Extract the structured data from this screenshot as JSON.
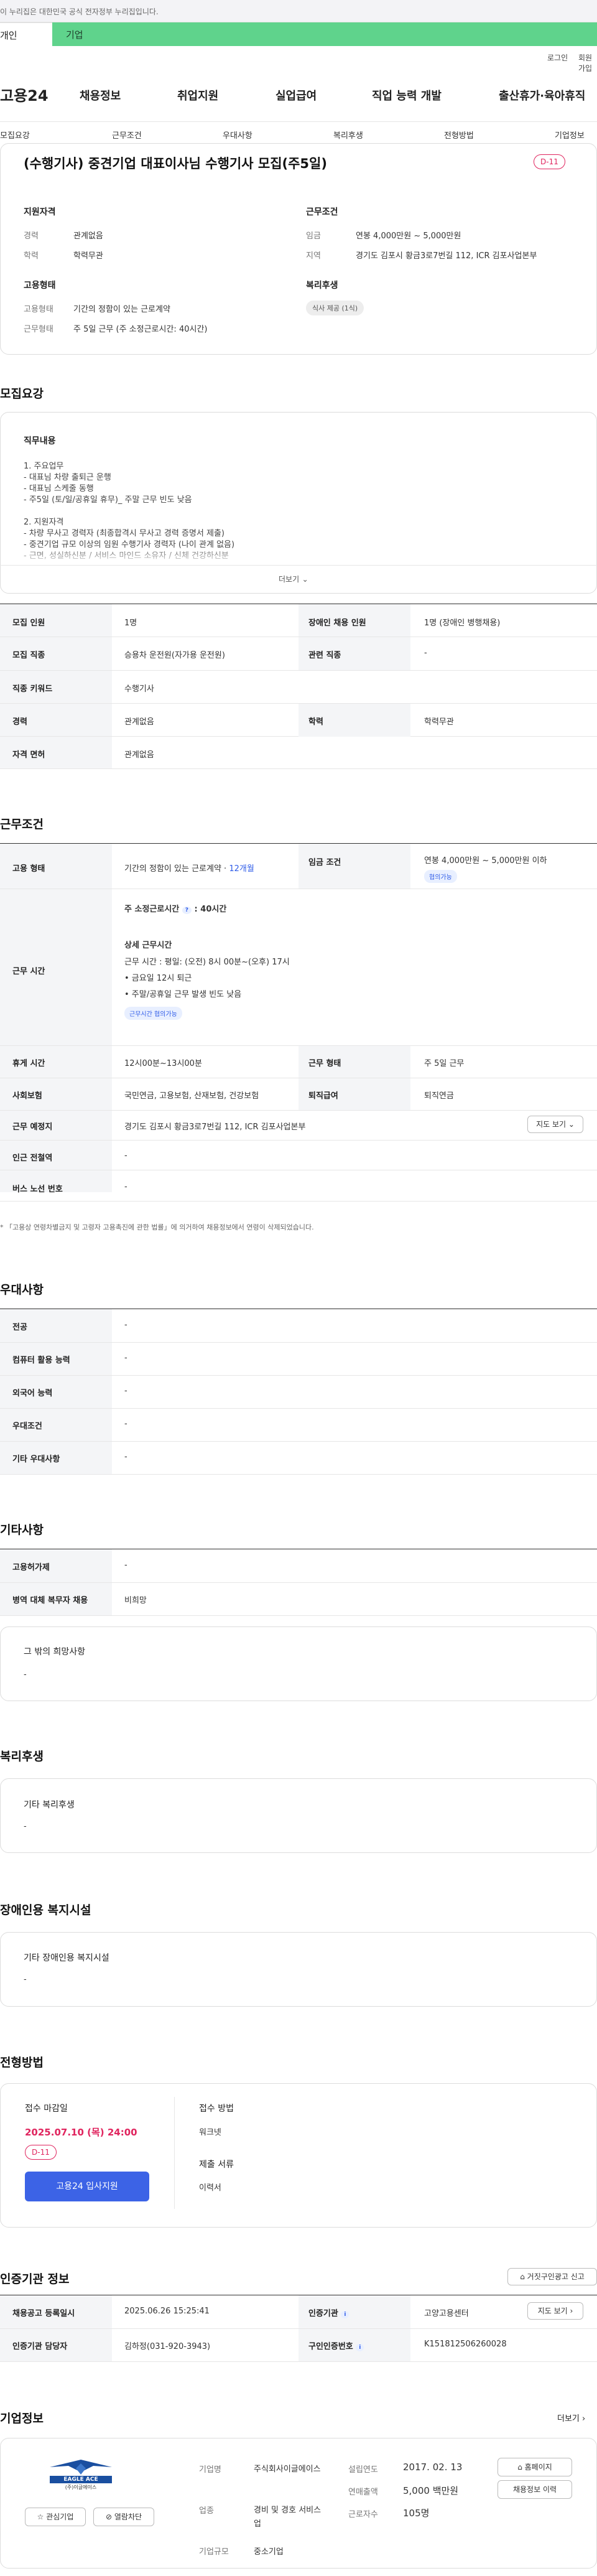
{
  "banner": {
    "text": "이 누리집은 대한민국 공식 전자정부 누리집입니다."
  },
  "user_tabs": {
    "user": "개인",
    "corp": "기업"
  },
  "utility": {
    "login": "로그인",
    "join": "회원가입"
  },
  "header": {
    "logo": "고용24",
    "gnb": [
      "채용정보",
      "취업지원",
      "실업급여",
      "직업 능력 개발",
      "출산휴가·육아휴직"
    ]
  },
  "subtabs": [
    "모집요강",
    "근무조건",
    "우대사항",
    "복리후생",
    "전형방법",
    "기업정보"
  ],
  "summary": {
    "title": "(수행기사) 중견기업 대표이사님 수행기사 모집(주5일)",
    "dday": "D-11",
    "qual": {
      "heading": "지원자격",
      "career_label": "경력",
      "career": "관계없음",
      "edu_label": "학력",
      "edu": "학력무관"
    },
    "cond": {
      "heading": "근무조건",
      "wage_label": "임금",
      "wage": "연봉 4,000만원 ~ 5,000만원",
      "loc_label": "지역",
      "loc": "경기도 김포시 황금3로7번길 112, ICR 김포사업본부"
    },
    "emp": {
      "heading": "고용형태",
      "type_label": "고용형태",
      "type": "기간의 정함이 있는 근로계약",
      "form_label": "근무형태",
      "form": "주 5일 근무 (주 소정근로시간: 40시간)"
    },
    "welfare": {
      "heading": "복리후생",
      "tag": "식사 제공 (1식)"
    }
  },
  "recruit": {
    "section_title": "모집요강",
    "duties_heading": "직무내용",
    "lines": [
      "1. 주요업무",
      "- 대표님 차량 출퇴근 운행",
      "- 대표님 스케줄 동행",
      "- 주5일 (토/일/공휴일 휴무)_ 주말 근무 빈도 낮음",
      "",
      "2. 지원자격",
      "- 차량 무사고 경력자 (최종합격시 무사고 경력 증명서 제출)",
      "- 중견기업 규모 이상의 임원 수행기사 경력자 (나이 관계 없음)",
      "- 근면, 성실하신분 / 서비스 마인드 소유자 / 신체 건강하신분"
    ],
    "more": "더보기"
  },
  "recruit_table": {
    "count_label": "모집 인원",
    "count": "1명",
    "disabled_label": "장애인 채용 인원",
    "disabled": "1명 (장애인 병행채용)",
    "job_label": "모집 직종",
    "job": "승용차 운전원(자가용 운전원)",
    "related_label": "관련 직종",
    "related": "-",
    "keyword_label": "직종 키워드",
    "keyword": "수행기사",
    "career_label": "경력",
    "career": "관계없음",
    "edu_label": "학력",
    "edu": "학력무관",
    "license_label": "자격 면허",
    "license": "관계없음"
  },
  "work": {
    "section_title": "근무조건",
    "emp_label": "고용 형태",
    "emp": "기간의 정함이 있는 근로계약 · ",
    "emp_months": "12개월",
    "wage_label": "임금 조건",
    "wage": "연봉 4,000만원 ~ 5,000만원 이하",
    "wage_tag": "협의가능",
    "hours_label": "근무 시간",
    "weekly_hours": "주 소정근로시간",
    "weekly_hours_value": "40시간",
    "detail_heading": "상세 근무시간",
    "detail": [
      "근무 시간 : 평일: (오전) 8시 00분~(오후) 17시",
      "• 금요일 12시 퇴근",
      "• 주말/공휴일 근무 발생 빈도 낮음"
    ],
    "hours_tag": "근무시간 협의가능",
    "break_label": "휴게 시간",
    "break": "12시00분~13시00분",
    "form_label": "근무 형태",
    "form": "주 5일 근무",
    "insurance_label": "사회보험",
    "insurance": "국민연금, 고용보험, 산재보험, 건강보험",
    "severance_label": "퇴직급여",
    "severance": "퇴직연금",
    "place_label": "근무 예정지",
    "place": "경기도 김포시 황금3로7번길 112, ICR 김포사업본부",
    "map_btn": "지도 보기",
    "subway_label": "인근 전철역",
    "subway": "-",
    "bus_label": "버스 노선 번호",
    "bus": "-",
    "note": "* 「고용상 연령차별금지 및 고령자 고용촉진에 관한 법률」에 의거하여 채용정보에서 연령이 삭제되었습니다."
  },
  "pref": {
    "section_title": "우대사항",
    "rows": [
      {
        "label": "전공",
        "value": "-"
      },
      {
        "label": "컴퓨터 활용 능력",
        "value": "-"
      },
      {
        "label": "외국어 능력",
        "value": "-"
      },
      {
        "label": "우대조건",
        "value": "-"
      },
      {
        "label": "기타 우대사항",
        "value": "-"
      }
    ]
  },
  "etc": {
    "section_title": "기타사항",
    "rows": [
      {
        "label": "고용허가제",
        "value": "-"
      },
      {
        "label": "병역 대체 복무자 채용",
        "value": "비희망"
      }
    ],
    "wish_heading": "그 밖의 희망사항",
    "wish": "-"
  },
  "welfare": {
    "section_title": "복리후생",
    "heading": "기타 복리후생",
    "value": "-"
  },
  "facility": {
    "section_title": "장애인용 복지시설",
    "heading": "기타 장애인용 복지시설",
    "value": "-"
  },
  "process": {
    "section_title": "전형방법",
    "deadline_label": "접수 마감일",
    "deadline": "2025.07.10 (목) 24:00",
    "dday": "D-11",
    "apply_btn": "고용24 입사지원",
    "method_label": "접수 방법",
    "method": "워크넷",
    "docs_label": "제출 서류",
    "docs": "이력서"
  },
  "agency": {
    "section_title": "인증기관 정보",
    "report_btn": "거짓구인광고 신고",
    "reg_label": "채용공고 등록일시",
    "reg": "2025.06.26 15:25:41",
    "agency_label": "인증기관",
    "agency": "고양고용센터",
    "map_btn": "지도 보기",
    "manager_label": "인증기관 담당자",
    "manager": "김하정(031-920-3943)",
    "number_label": "구인인증번호",
    "number": "K151812506260028"
  },
  "company": {
    "section_title": "기업정보",
    "more": "더보기",
    "logo_text": "EAGLE ACE",
    "logo_sub": "(주)이글에이스",
    "interest_btn": "관심기업",
    "block_btn": "열람차단",
    "name_label": "기업명",
    "name": "주식회사이글에이스",
    "industry_label": "업종",
    "industry": "경비 및 경호 서비스업",
    "size_label": "기업규모",
    "size": "중소기업",
    "founded_label": "설립연도",
    "founded": "2017. 02. 13",
    "sales_label": "연매출액",
    "sales": "5,000 백만원",
    "employees_label": "근로자수",
    "employees": "105명",
    "homepage_btn": "홈페이지",
    "jobs_btn": "채용정보 이력"
  }
}
